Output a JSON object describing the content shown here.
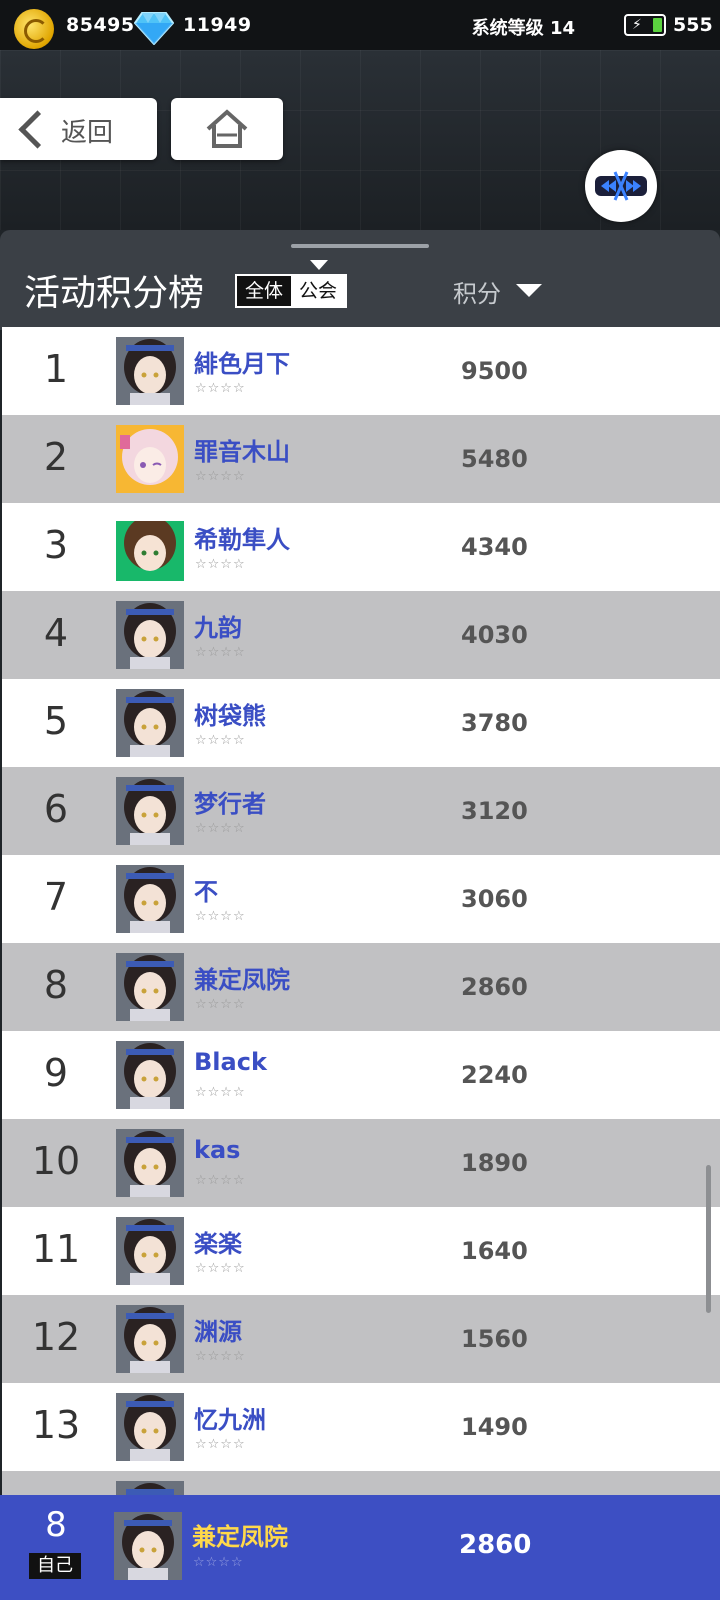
{
  "status": {
    "coins": "85495",
    "gems": "11949",
    "system_level": "系统等级 14",
    "stamina": "555"
  },
  "nav": {
    "back_label": "返回"
  },
  "panel": {
    "title": "活动积分榜",
    "tab_all": "全体",
    "tab_guild": "公会",
    "score_header": "积分"
  },
  "rows": [
    {
      "rank": "1",
      "name": "緋色月下",
      "stars": "☆☆☆☆",
      "score": "9500",
      "avatar": "dark"
    },
    {
      "rank": "2",
      "name": "罪音木山",
      "stars": "☆☆☆☆",
      "score": "5480",
      "avatar": "pink"
    },
    {
      "rank": "3",
      "name": "希勒隼人",
      "stars": "☆☆☆☆",
      "score": "4340",
      "avatar": "green"
    },
    {
      "rank": "4",
      "name": "九韵",
      "stars": "☆☆☆☆",
      "score": "4030",
      "avatar": "dark"
    },
    {
      "rank": "5",
      "name": "树袋熊",
      "stars": "☆☆☆☆",
      "score": "3780",
      "avatar": "dark"
    },
    {
      "rank": "6",
      "name": "梦行者",
      "stars": "☆☆☆☆",
      "score": "3120",
      "avatar": "dark"
    },
    {
      "rank": "7",
      "name": "不",
      "stars": "☆☆☆☆",
      "score": "3060",
      "avatar": "dark"
    },
    {
      "rank": "8",
      "name": "兼定凤院",
      "stars": "☆☆☆☆",
      "score": "2860",
      "avatar": "dark"
    },
    {
      "rank": "9",
      "name": "Black",
      "stars": "☆☆☆☆",
      "score": "2240",
      "avatar": "dark"
    },
    {
      "rank": "10",
      "name": "kas",
      "stars": "☆☆☆☆",
      "score": "1890",
      "avatar": "dark"
    },
    {
      "rank": "11",
      "name": "楽楽",
      "stars": "☆☆☆☆",
      "score": "1640",
      "avatar": "dark"
    },
    {
      "rank": "12",
      "name": "渊源",
      "stars": "☆☆☆☆",
      "score": "1560",
      "avatar": "dark"
    },
    {
      "rank": "13",
      "name": "忆九洲",
      "stars": "☆☆☆☆",
      "score": "1490",
      "avatar": "dark"
    },
    {
      "rank": "",
      "name": "",
      "stars": "",
      "score": "",
      "avatar": "dark"
    }
  ],
  "self": {
    "rank": "8",
    "tag": "自己",
    "name": "兼定凤院",
    "stars": "☆☆☆☆",
    "score": "2860"
  }
}
